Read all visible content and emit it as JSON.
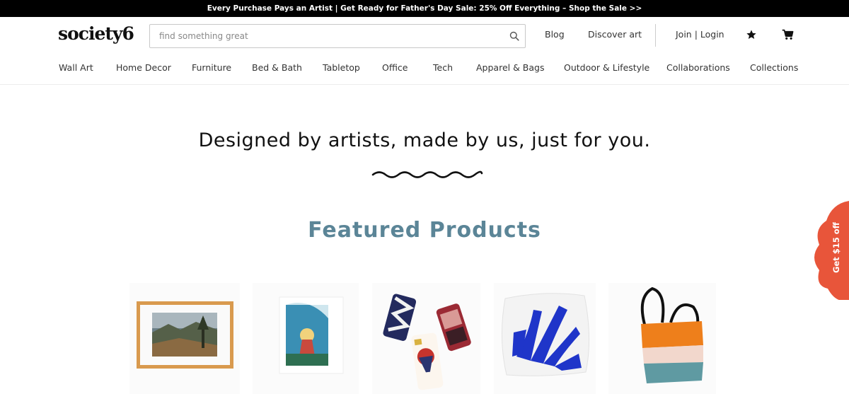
{
  "promo_bar": {
    "text": "Every Purchase Pays an Artist | Get Ready for Father's Day Sale: 25% Off Everything – Shop the Sale >>"
  },
  "header": {
    "logo": "society6",
    "search_placeholder": "find something great",
    "blog": "Blog",
    "discover_art": "Discover art",
    "join_login": "Join | Login",
    "icons": [
      "search-icon",
      "star-icon",
      "cart-icon"
    ]
  },
  "nav": {
    "items": [
      "Wall Art",
      "Home Decor",
      "Furniture",
      "Bed & Bath",
      "Tabletop",
      "Office",
      "Tech",
      "Apparel & Bags",
      "Outdoor & Lifestyle",
      "Collaborations",
      "Collections"
    ]
  },
  "hero": {
    "tagline": "Designed by artists, made by us, just for you."
  },
  "featured": {
    "title": "Featured Products",
    "products": [
      "framed-art-print",
      "art-print",
      "phone-cases",
      "throw-pillow",
      "tote-bag"
    ]
  },
  "promo_tab": {
    "label": "Get $15 off",
    "color": "#e8553a"
  },
  "colors": {
    "featured_title": "#5b8597",
    "promo_bar_bg": "#000000"
  }
}
